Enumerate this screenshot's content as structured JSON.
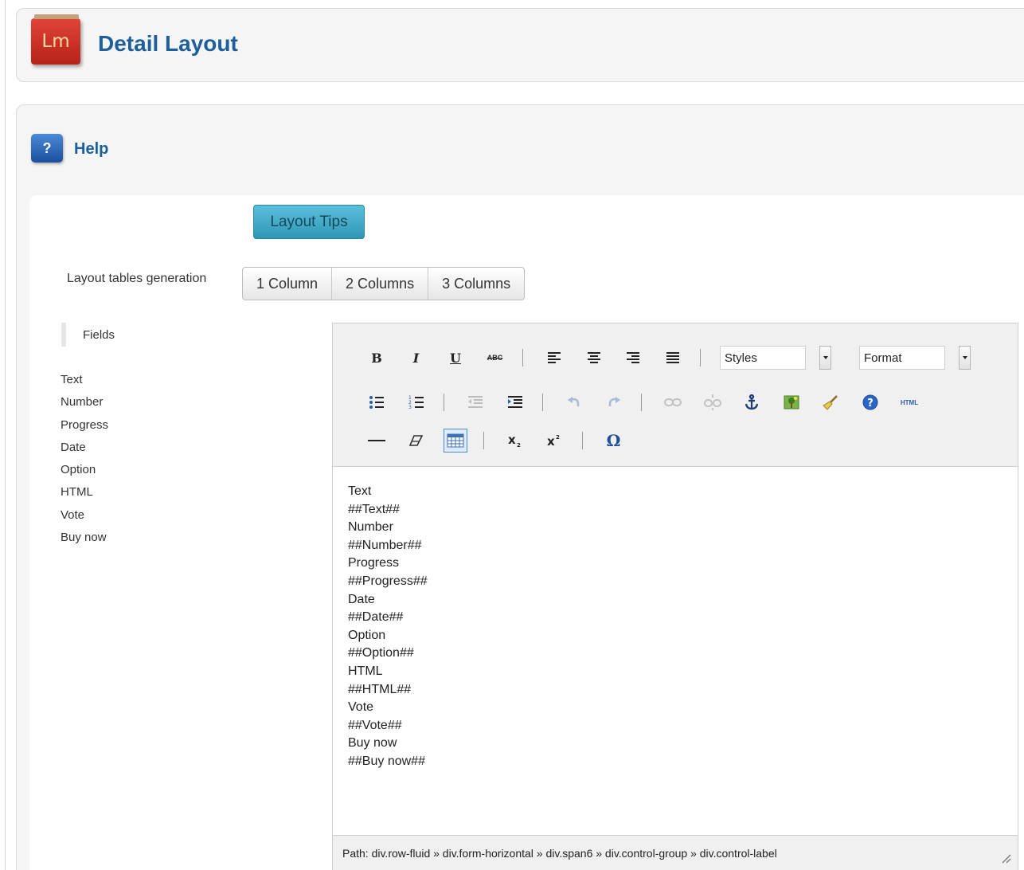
{
  "header": {
    "logo_text": "Lm",
    "title": "Detail Layout"
  },
  "help": {
    "label": "Help",
    "icon": "?"
  },
  "layout_tips_label": "Layout Tips",
  "generation": {
    "label": "Layout tables generation",
    "buttons": [
      "1 Column",
      "2 Columns",
      "3 Columns"
    ]
  },
  "fields": {
    "heading": "Fields",
    "items": [
      "Text",
      "Number",
      "Progress",
      "Date",
      "Option",
      "HTML",
      "Vote",
      "Buy now"
    ]
  },
  "editor": {
    "styles_label": "Styles",
    "format_label": "Format",
    "html_button": "HTML",
    "body_lines": [
      "Text",
      "##Text##",
      "Number",
      "##Number##",
      "Progress",
      "##Progress##",
      "Date",
      "##Date##",
      "Option",
      "##Option##",
      "HTML",
      "##HTML##",
      "Vote",
      "##Vote##",
      "Buy now",
      "##Buy now##"
    ],
    "status_path": "Path: div.row-fluid » div.form-horizontal » div.span6 » div.control-group » div.control-label"
  },
  "colors": {
    "title_blue": "#1d5f9a",
    "tips_button": "#5bc0de",
    "logo_red": "#c8281e"
  }
}
